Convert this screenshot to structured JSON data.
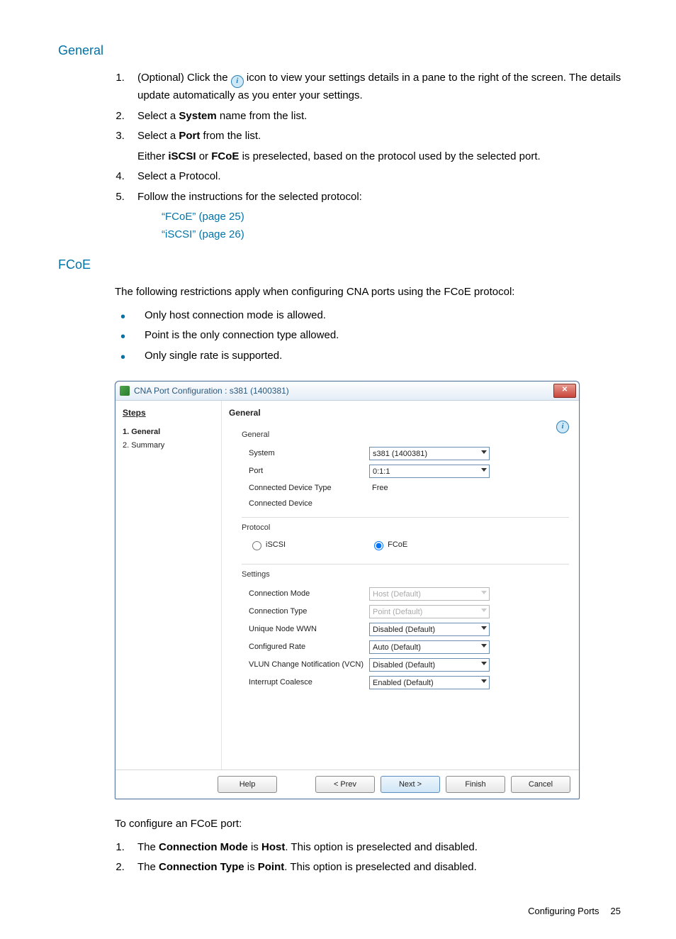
{
  "sections": {
    "general": {
      "heading": "General"
    },
    "fcoe": {
      "heading": "FCoE"
    }
  },
  "general_steps": {
    "s1a": "(Optional) Click the ",
    "s1b": " icon to view your settings details in a pane to the right of the screen. The details update automatically as you enter your settings.",
    "s2a": "Select a ",
    "s2b": "System",
    "s2c": " name from the list.",
    "s3a": "Select a ",
    "s3b": "Port",
    "s3c": " from the list.",
    "s3_sub_a": "Either ",
    "s3_sub_b": "iSCSI",
    "s3_sub_c": " or ",
    "s3_sub_d": "FCoE",
    "s3_sub_e": " is preselected, based on the protocol used by the selected port.",
    "s4": "Select a Protocol.",
    "s5": "Follow the instructions for the selected protocol:",
    "link1": "“FCoE” (page 25)",
    "link2": "“iSCSI” (page 26)"
  },
  "fcoe_intro": "The following restrictions apply when configuring CNA ports using the FCoE protocol:",
  "fcoe_bullets": {
    "b1": "Only host connection mode is allowed.",
    "b2": "Point is the only connection type allowed.",
    "b3": "Only single rate is supported."
  },
  "dialog": {
    "title": "CNA Port Configuration : s381 (1400381)",
    "close": "✕",
    "steps_hdr": "Steps",
    "main_hdr": "General",
    "step1": "1. General",
    "step2": "2. Summary",
    "grp_general": "General",
    "lbl_system": "System",
    "val_system": "s381 (1400381)",
    "lbl_port": "Port",
    "val_port": "0:1:1",
    "lbl_cdt": "Connected Device Type",
    "val_cdt": "Free",
    "lbl_cd": "Connected Device",
    "grp_protocol": "Protocol",
    "radio_iscsi": "iSCSI",
    "radio_fcoe": "FCoE",
    "grp_settings": "Settings",
    "lbl_connmode": "Connection Mode",
    "val_connmode": "Host (Default)",
    "lbl_conntype": "Connection Type",
    "val_conntype": "Point (Default)",
    "lbl_unw": "Unique Node WWN",
    "val_unw": "Disabled (Default)",
    "lbl_rate": "Configured Rate",
    "val_rate": "Auto (Default)",
    "lbl_vcn": "VLUN Change Notification (VCN)",
    "val_vcn": "Disabled (Default)",
    "lbl_ic": "Interrupt Coalesce",
    "val_ic": "Enabled (Default)",
    "btn_help": "Help",
    "btn_prev": "< Prev",
    "btn_next": "Next >",
    "btn_finish": "Finish",
    "btn_cancel": "Cancel"
  },
  "fcoe_config_intro": "To configure an FCoE port:",
  "fcoe_config": {
    "s1a": "The ",
    "s1b": "Connection Mode",
    "s1c": " is ",
    "s1d": "Host",
    "s1e": ". This option is preselected and disabled.",
    "s2a": "The ",
    "s2b": "Connection Type",
    "s2c": " is ",
    "s2d": "Point",
    "s2e": ". This option is preselected and disabled."
  },
  "footer": {
    "label": "Configuring Ports",
    "page": "25"
  }
}
